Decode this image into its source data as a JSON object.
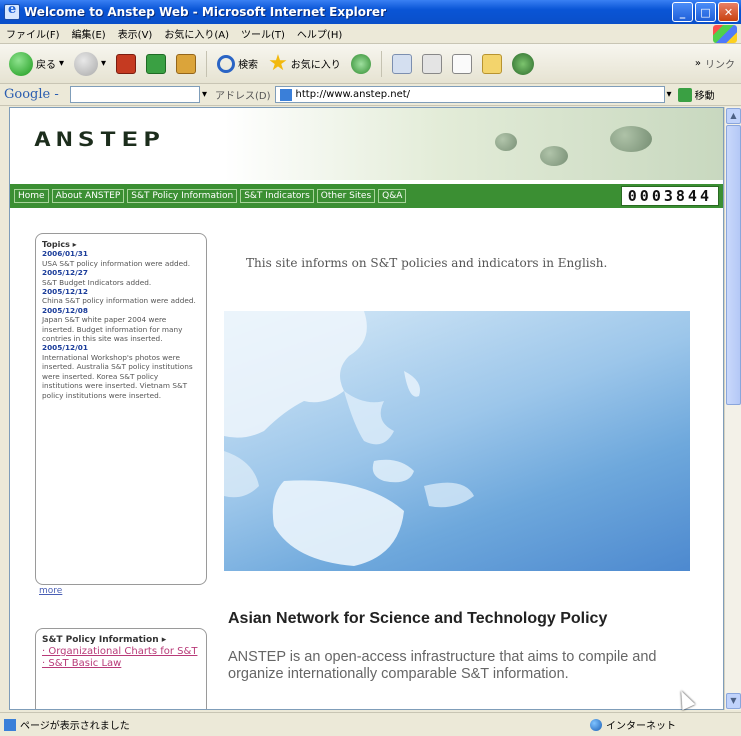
{
  "window": {
    "title": "Welcome to Anstep Web - Microsoft Internet Explorer",
    "controls": {
      "minimize": "_",
      "maximize": "□",
      "close": "✕"
    }
  },
  "menubar": {
    "items": [
      "ファイル(F)",
      "編集(E)",
      "表示(V)",
      "お気に入り(A)",
      "ツール(T)",
      "ヘルプ(H)"
    ]
  },
  "toolbar": {
    "back_label": "戻る",
    "search_label": "検索",
    "favorites_label": "お気に入り",
    "links_label": "リンク",
    "chevron": "»"
  },
  "google_bar": {
    "logo": "Google -",
    "address_label": "アドレス(D)",
    "url": "http://www.anstep.net/",
    "go_label": "移動"
  },
  "page": {
    "logo": "ANSTEP",
    "nav": [
      "Home",
      "About ANSTEP",
      "S&T Policy Information",
      "S&T Indicators",
      "Other Sites",
      "Q&A"
    ],
    "counter": "0003844",
    "topics": {
      "header": "Topics ▸",
      "entries": [
        {
          "date": "2006/01/31",
          "text": "USA S&T policy information were added."
        },
        {
          "date": "2005/12/27",
          "text": "S&T Budget Indicators added."
        },
        {
          "date": "2005/12/12",
          "text": "China S&T policy information were added."
        },
        {
          "date": "2005/12/08",
          "text": "Japan S&T white paper 2004 were inserted. Budget information for many contries in this site was inserted."
        },
        {
          "date": "2005/12/01",
          "text": "International Workshop's photos were inserted. Australia S&T policy institutions were inserted. Korea S&T policy institutions were inserted. Vietnam S&T policy institutions were inserted."
        }
      ]
    },
    "more_link": "more",
    "policy_box": {
      "header": "S&T Policy Information ▸",
      "links": [
        "· Organizational Charts for S&T",
        "· S&T Basic Law"
      ]
    },
    "intro": "This site informs on S&T policies and indicators in English.",
    "heading": "Asian Network for Science and Technology Policy",
    "description": "ANSTEP is an open-access infrastructure that aims to compile and organize internationally comparable S&T information."
  },
  "statusbar": {
    "status": "ページが表示されました",
    "zone": "インターネット"
  },
  "colors": {
    "nav_green": "#3b8f33",
    "title_blue": "#0a55d6",
    "date_blue": "#1a3c9a",
    "link_pink": "#b83a78"
  }
}
